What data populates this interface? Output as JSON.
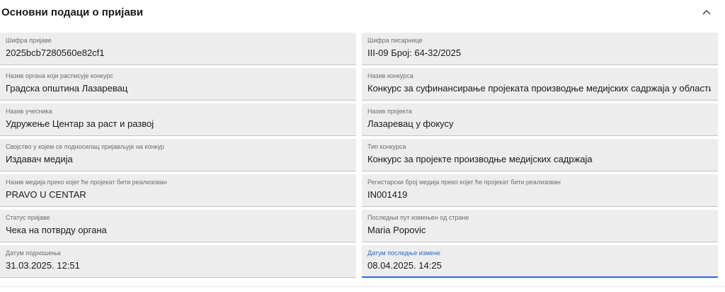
{
  "section": {
    "title": "Основни подаци о пријави",
    "collapse_icon": "chevron-up-icon"
  },
  "fields": [
    {
      "label": "Шифра пријаве",
      "value": "2025bcb7280560e82cf1"
    },
    {
      "label": "Шифра писарнице",
      "value": "III-09 Број: 64-32/2025"
    },
    {
      "label": "Назив органа који расписује конкурс",
      "value": "Градска општина Лазаревац"
    },
    {
      "label": "Назив конкурса",
      "value": "Конкурс за суфинансирање пројеката производње медијских садржаја у области"
    },
    {
      "label": "Назив учесника",
      "value": "Удружење Центар за раст и развој"
    },
    {
      "label": "Назив пројекта",
      "value": "Лазаревац у фокусу"
    },
    {
      "label": "Својство у којем се подносилац пријављује на конкур",
      "value": "Издавач медија"
    },
    {
      "label": "Тип конкурса",
      "value": "Конкурс за пројекте производње медијских садржаја"
    },
    {
      "label": "Назив медија преко којег ће пројекат бити реализован",
      "value": "PRAVO U CENTAR"
    },
    {
      "label": "Регистарски број медија преко којег ће пројекат бити реализован",
      "value": "IN001419"
    },
    {
      "label": "Статус пријаве",
      "value": "Чека на потврду органа"
    },
    {
      "label": "Последњи пут измењен од стране",
      "value": "Maria Popovic"
    },
    {
      "label": "Датум подношења",
      "value": "31.03.2025. 12:51"
    },
    {
      "label": "Датум последње измене",
      "value": "08.04.2025. 14:25"
    }
  ],
  "colors": {
    "accent": "#2b6bd4",
    "field_bg": "#ededed"
  }
}
